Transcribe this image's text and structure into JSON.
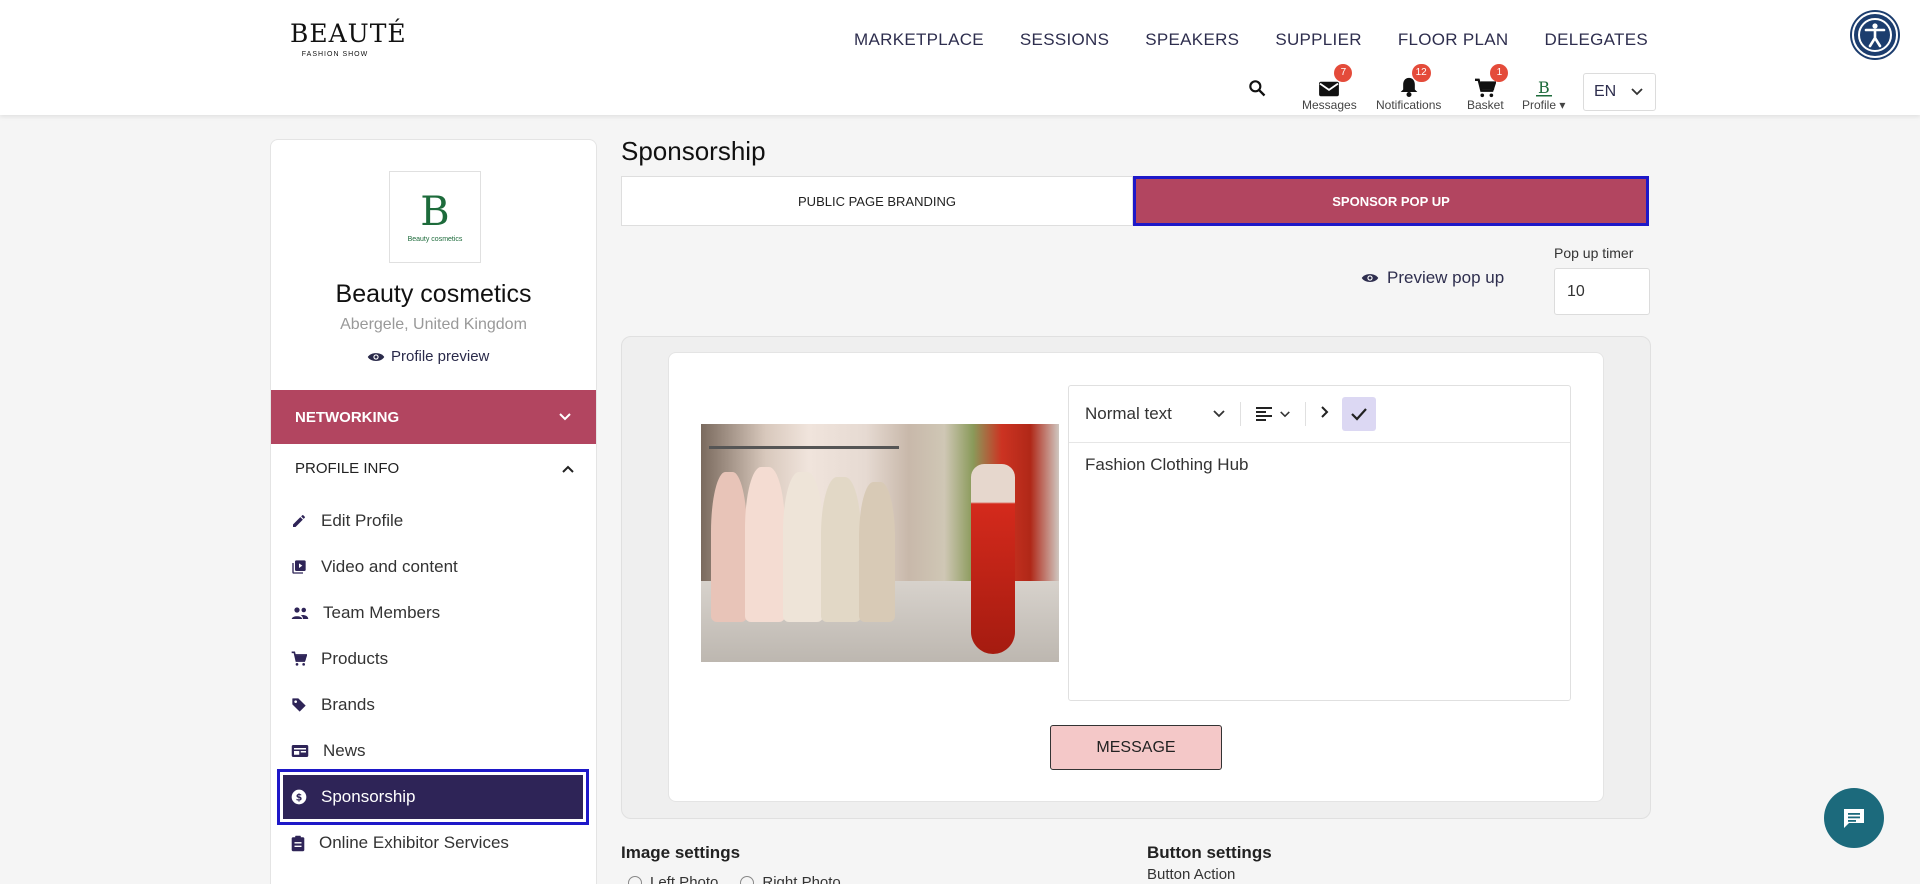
{
  "header": {
    "logo_main": "BEAUTÉ",
    "logo_sub": "FASHION SHOW",
    "nav": [
      "MARKETPLACE",
      "SESSIONS",
      "SPEAKERS",
      "SUPPLIER",
      "FLOOR PLAN",
      "DELEGATES"
    ],
    "messages_label": "Messages",
    "messages_count": "7",
    "notifications_label": "Notifications",
    "notifications_count": "12",
    "basket_label": "Basket",
    "basket_count": "1",
    "profile_label": "Profile",
    "language": "EN"
  },
  "sidebar": {
    "logo_letter": "B",
    "logo_text": "Beauty cosmetics",
    "company_name": "Beauty cosmetics",
    "location": "Abergele, United Kingdom",
    "profile_preview": "Profile preview",
    "networking": "NETWORKING",
    "profile_info": "PROFILE INFO",
    "items": [
      {
        "label": "Edit Profile",
        "icon": "pencil-icon"
      },
      {
        "label": "Video and content",
        "icon": "video-library-icon"
      },
      {
        "label": "Team Members",
        "icon": "people-icon"
      },
      {
        "label": "Products",
        "icon": "cart-icon"
      },
      {
        "label": "Brands",
        "icon": "tag-icon"
      },
      {
        "label": "News",
        "icon": "news-icon"
      },
      {
        "label": "Sponsorship",
        "icon": "dollar-icon"
      },
      {
        "label": "Online Exhibitor Services",
        "icon": "clipboard-icon"
      }
    ]
  },
  "main": {
    "title": "Sponsorship",
    "tabs": [
      "PUBLIC PAGE BRANDING",
      "SPONSOR POP UP"
    ],
    "preview_popup": "Preview pop up",
    "popup_timer_label": "Pop up timer",
    "popup_timer_value": "10",
    "editor": {
      "text_style": "Normal text",
      "content": "Fashion Clothing Hub"
    },
    "message_button": "MESSAGE",
    "image_settings": "Image settings",
    "left_photo": "Left Photo",
    "right_photo": "Right Photo",
    "button_settings": "Button settings",
    "button_action": "Button Action"
  },
  "colors": {
    "accent": "#b24560",
    "active_nav": "#2e2457",
    "highlight_border": "#1e18c8"
  }
}
